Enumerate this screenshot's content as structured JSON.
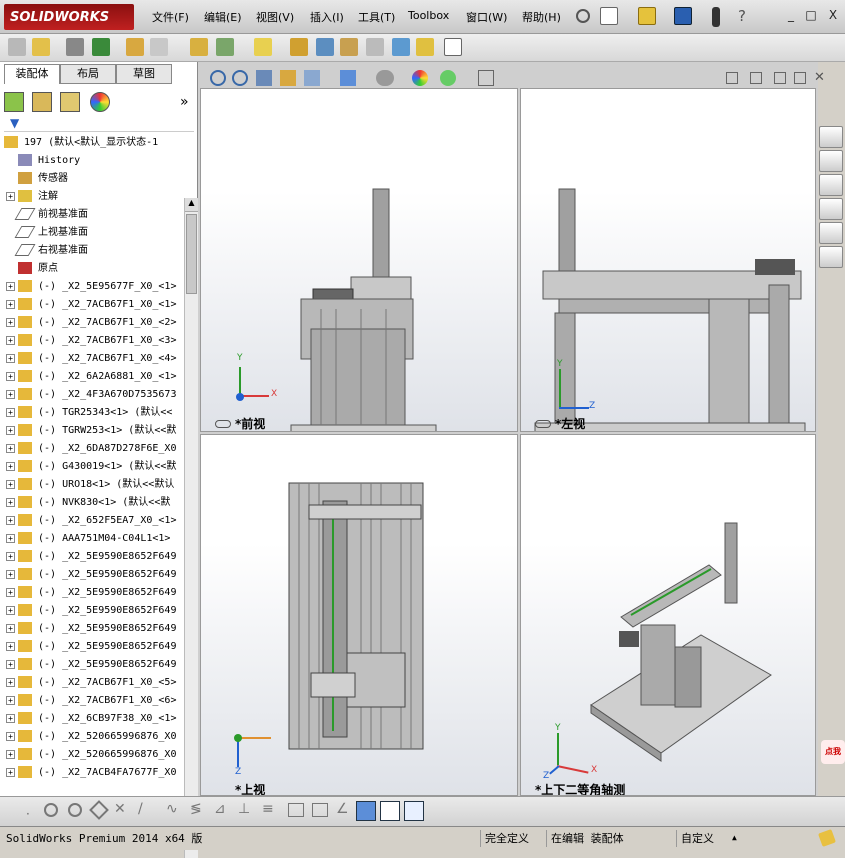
{
  "app": {
    "logo": "SOLIDWORKS"
  },
  "menu": [
    "文件(F)",
    "编辑(E)",
    "视图(V)",
    "插入(I)",
    "工具(T)",
    "Toolbox",
    "窗口(W)",
    "帮助(H)"
  ],
  "window_buttons": [
    "_",
    "□",
    "X"
  ],
  "panel_tabs": [
    "装配体",
    "布局",
    "草图"
  ],
  "tree": {
    "root": "197  (默认<默认_显示状态-1",
    "items": [
      {
        "label": "History",
        "icon": "history-icon",
        "exp": false
      },
      {
        "label": "传感器",
        "icon": "sensor-icon",
        "exp": false
      },
      {
        "label": "注解",
        "icon": "annotation-icon",
        "exp": true
      },
      {
        "label": "前视基准面",
        "icon": "plane-icon",
        "exp": false
      },
      {
        "label": "上视基准面",
        "icon": "plane-icon",
        "exp": false
      },
      {
        "label": "右视基准面",
        "icon": "plane-icon",
        "exp": false
      },
      {
        "label": "原点",
        "icon": "origin-icon",
        "exp": false
      },
      {
        "label": "(-) _X2_5E95677F_X0_<1>",
        "icon": "component-icon",
        "exp": true
      },
      {
        "label": "(-) _X2_7ACB67F1_X0_<1>",
        "icon": "component-icon",
        "exp": true
      },
      {
        "label": "(-) _X2_7ACB67F1_X0_<2>",
        "icon": "component-icon",
        "exp": true
      },
      {
        "label": "(-) _X2_7ACB67F1_X0_<3>",
        "icon": "component-icon",
        "exp": true
      },
      {
        "label": "(-) _X2_7ACB67F1_X0_<4>",
        "icon": "component-icon",
        "exp": true
      },
      {
        "label": "(-) _X2_6A2A6881_X0_<1>",
        "icon": "component-icon",
        "exp": true
      },
      {
        "label": "(-) _X2_4F3A670D7535673",
        "icon": "component-icon",
        "exp": true
      },
      {
        "label": "(-) TGR25343<1> (默认<<",
        "icon": "component-icon",
        "exp": true
      },
      {
        "label": "(-) TGRW253<1> (默认<<默",
        "icon": "component-icon",
        "exp": true
      },
      {
        "label": "(-) _X2_6DA87D278F6E_X0",
        "icon": "component-icon",
        "exp": true
      },
      {
        "label": "(-) G430019<1> (默认<<默",
        "icon": "component-icon",
        "exp": true
      },
      {
        "label": "(-) URO18<1> (默认<<默认",
        "icon": "component-icon",
        "exp": true
      },
      {
        "label": "(-) NVK830<1> (默认<<默",
        "icon": "component-icon",
        "exp": true
      },
      {
        "label": "(-) _X2_652F5EA7_X0_<1>",
        "icon": "component-icon",
        "exp": true
      },
      {
        "label": "(-) AAA751M04-C04L1<1>",
        "icon": "component-icon",
        "exp": true
      },
      {
        "label": "(-) _X2_5E9590E8652F649",
        "icon": "component-icon",
        "exp": true
      },
      {
        "label": "(-) _X2_5E9590E8652F649",
        "icon": "component-icon",
        "exp": true
      },
      {
        "label": "(-) _X2_5E9590E8652F649",
        "icon": "component-icon",
        "exp": true
      },
      {
        "label": "(-) _X2_5E9590E8652F649",
        "icon": "component-icon",
        "exp": true
      },
      {
        "label": "(-) _X2_5E9590E8652F649",
        "icon": "component-icon",
        "exp": true
      },
      {
        "label": "(-) _X2_5E9590E8652F649",
        "icon": "component-icon",
        "exp": true
      },
      {
        "label": "(-) _X2_5E9590E8652F649",
        "icon": "component-icon",
        "exp": true
      },
      {
        "label": "(-) _X2_7ACB67F1_X0_<5>",
        "icon": "component-icon",
        "exp": true
      },
      {
        "label": "(-) _X2_7ACB67F1_X0_<6>",
        "icon": "component-icon",
        "exp": true
      },
      {
        "label": "(-) _X2_6CB97F38_X0_<1>",
        "icon": "component-icon",
        "exp": true
      },
      {
        "label": "(-) _X2_520665996876_X0",
        "icon": "component-icon",
        "exp": true
      },
      {
        "label": "(-) _X2_520665996876_X0",
        "icon": "component-icon",
        "exp": true
      },
      {
        "label": "(-) _X2_7ACB4FA7677F_X0",
        "icon": "component-icon",
        "exp": true
      }
    ]
  },
  "viewports": [
    {
      "label": "*前视"
    },
    {
      "label": "*左视"
    },
    {
      "label": "*上视"
    },
    {
      "label": "*上下二等角轴测"
    }
  ],
  "axis": {
    "x": "X",
    "y": "Y",
    "z": "Z"
  },
  "corner_badge": "点我",
  "status": {
    "product": "SolidWorks Premium 2014 x64 版",
    "state": "完全定义",
    "editing": "在编辑 装配体",
    "units": "自定义"
  }
}
